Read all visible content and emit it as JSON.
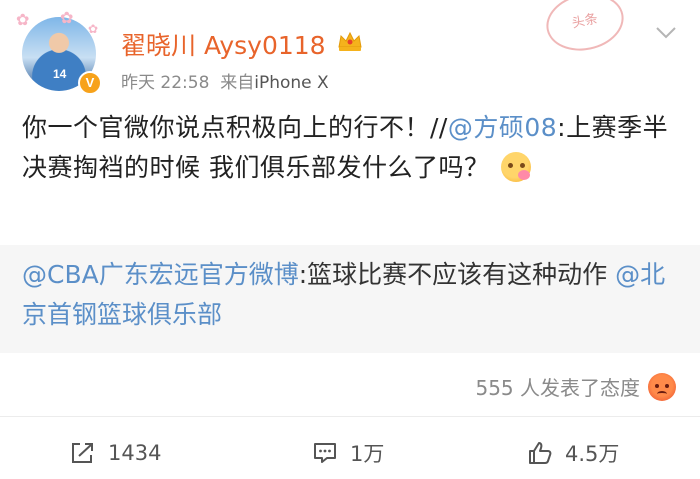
{
  "header": {
    "username": "翟晓川 Aysy0118",
    "time": "昨天 22:58",
    "source_prefix": "来自",
    "source": "iPhone X",
    "stamp_text": "头条",
    "verified_badge": "V",
    "avatar_number": "14"
  },
  "post": {
    "text_main": "你一个官微你说点积极向上的行不！//",
    "mention": "@方硕08",
    "text_rest": ":上赛季半决赛掏裆的时候 我们俱乐部发什么了吗？"
  },
  "repost": {
    "mention_1": "@CBA广东宏远官方微博",
    "text": ":篮球比赛不应该有这种动作 ",
    "mention_2": "@北京首钢篮球俱乐部"
  },
  "reactions": {
    "label": "555 人发表了态度"
  },
  "actions": {
    "repost_count": "1434",
    "comment_count": "1万",
    "like_count": "4.5万"
  },
  "colors": {
    "username": "#e8642b",
    "link": "#5b8fc8",
    "repost_bg": "#f6f6f6"
  },
  "icons": [
    "crown-icon",
    "chevron-down-icon",
    "smiling-emoji-icon",
    "angry-icon",
    "repost-icon",
    "comment-icon",
    "like-icon"
  ]
}
